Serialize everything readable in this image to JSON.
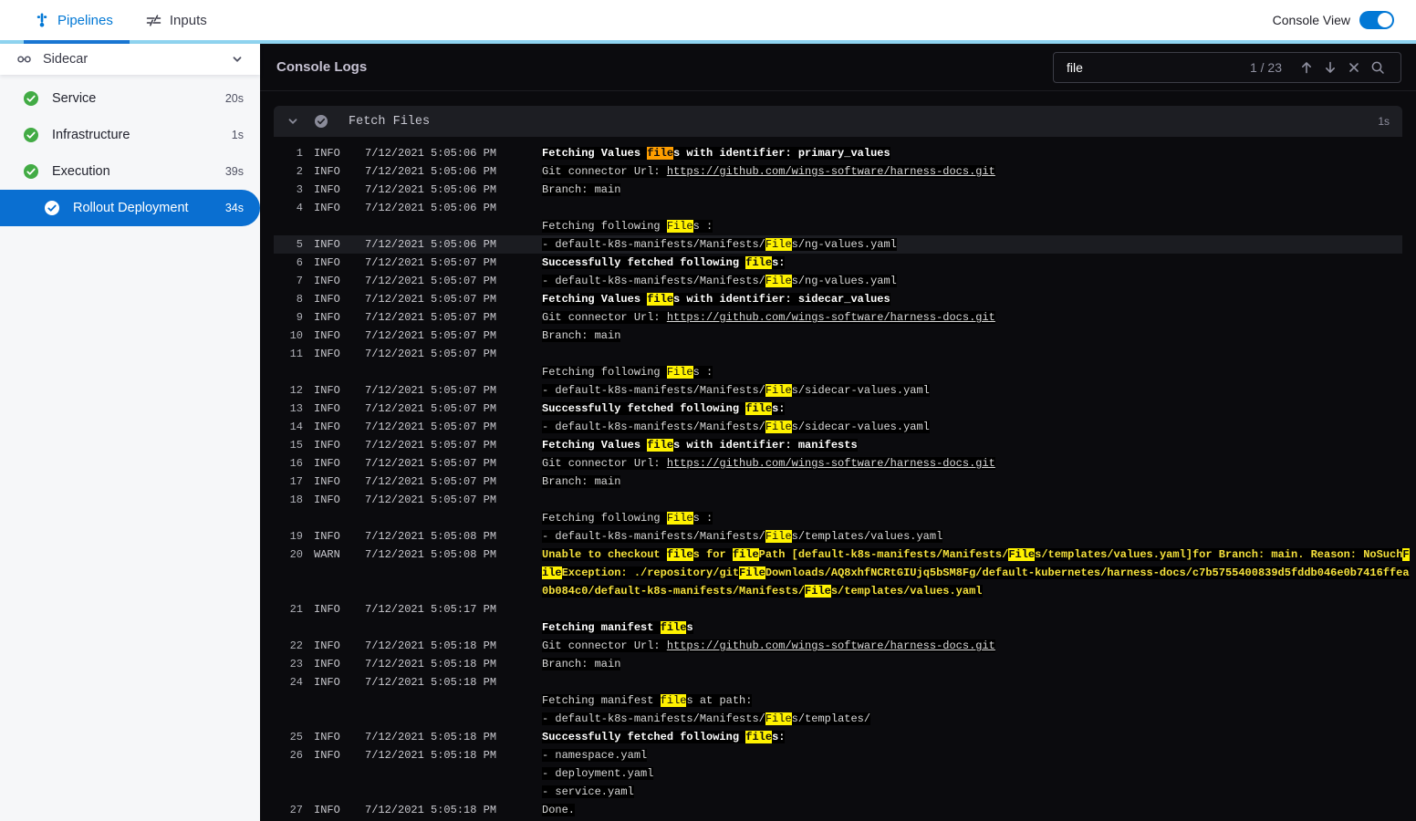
{
  "colors": {
    "accent_blue": "#0278d5",
    "selected_step_blue": "#0a6fd1",
    "tab_track_lightblue": "#8ed3ef",
    "tab_indicator_blue": "#1976d2",
    "success_green": "#42ab45",
    "console_bg": "#0b0b0e",
    "warn_yellow": "#f5e13c",
    "match_highlight": "#fff200",
    "current_match_highlight": "#ff9e00"
  },
  "topbar": {
    "tabs": [
      {
        "label": "Pipelines",
        "active": true
      },
      {
        "label": "Inputs",
        "active": false
      }
    ],
    "console_view_label": "Console View",
    "console_view_on": true
  },
  "sidebar": {
    "title": "Sidecar",
    "items": [
      {
        "label": "Service",
        "duration": "20s",
        "status": "success",
        "selected": false
      },
      {
        "label": "Infrastructure",
        "duration": "1s",
        "status": "success",
        "selected": false
      },
      {
        "label": "Execution",
        "duration": "39s",
        "status": "success",
        "selected": false
      },
      {
        "label": "Rollout Deployment",
        "duration": "34s",
        "status": "success",
        "selected": true
      }
    ]
  },
  "console": {
    "title": "Console Logs",
    "search": {
      "value": "file",
      "counter": "1 / 23"
    },
    "section": {
      "title": "Fetch Files",
      "duration": "1s"
    },
    "logs": [
      {
        "n": 1,
        "lv": "INFO",
        "ts": "7/12/2021 5:05:06 PM",
        "lines": [
          [
            {
              "t": "Fetching Values ",
              "s": "b"
            },
            {
              "t": "file",
              "s": "b",
              "h": "c"
            },
            {
              "t": "s with identifier: primary_values",
              "s": "b"
            }
          ]
        ]
      },
      {
        "n": 2,
        "lv": "INFO",
        "ts": "7/12/2021 5:05:06 PM",
        "lines": [
          [
            {
              "t": "Git connector Url: "
            },
            {
              "t": "https://github.com/wings-software/harness-docs.git",
              "s": "l"
            }
          ]
        ]
      },
      {
        "n": 3,
        "lv": "INFO",
        "ts": "7/12/2021 5:05:06 PM",
        "lines": [
          [
            {
              "t": "Branch: main"
            }
          ]
        ]
      },
      {
        "n": 4,
        "lv": "INFO",
        "ts": "7/12/2021 5:05:06 PM",
        "lines": [
          [],
          [
            {
              "t": "Fetching following "
            },
            {
              "t": "File",
              "h": "m"
            },
            {
              "t": "s :"
            }
          ]
        ]
      },
      {
        "n": 5,
        "lv": "INFO",
        "ts": "7/12/2021 5:05:06 PM",
        "sel": true,
        "lines": [
          [
            {
              "t": "- default-k8s-manifests/Manifests/"
            },
            {
              "t": "File",
              "h": "m"
            },
            {
              "t": "s/ng-values.yaml"
            }
          ]
        ]
      },
      {
        "n": 6,
        "lv": "INFO",
        "ts": "7/12/2021 5:05:07 PM",
        "lines": [
          [
            {
              "t": "Successfully fetched following ",
              "s": "b"
            },
            {
              "t": "file",
              "s": "b",
              "h": "m"
            },
            {
              "t": "s:",
              "s": "b"
            }
          ]
        ]
      },
      {
        "n": 7,
        "lv": "INFO",
        "ts": "7/12/2021 5:05:07 PM",
        "lines": [
          [
            {
              "t": "- default-k8s-manifests/Manifests/"
            },
            {
              "t": "File",
              "h": "m"
            },
            {
              "t": "s/ng-values.yaml"
            }
          ]
        ]
      },
      {
        "n": 8,
        "lv": "INFO",
        "ts": "7/12/2021 5:05:07 PM",
        "lines": [
          [
            {
              "t": "Fetching Values ",
              "s": "b"
            },
            {
              "t": "file",
              "s": "b",
              "h": "m"
            },
            {
              "t": "s with identifier: sidecar_values",
              "s": "b"
            }
          ]
        ]
      },
      {
        "n": 9,
        "lv": "INFO",
        "ts": "7/12/2021 5:05:07 PM",
        "lines": [
          [
            {
              "t": "Git connector Url: "
            },
            {
              "t": "https://github.com/wings-software/harness-docs.git",
              "s": "l"
            }
          ]
        ]
      },
      {
        "n": 10,
        "lv": "INFO",
        "ts": "7/12/2021 5:05:07 PM",
        "lines": [
          [
            {
              "t": "Branch: main"
            }
          ]
        ]
      },
      {
        "n": 11,
        "lv": "INFO",
        "ts": "7/12/2021 5:05:07 PM",
        "lines": [
          [],
          [
            {
              "t": "Fetching following "
            },
            {
              "t": "File",
              "h": "m"
            },
            {
              "t": "s :"
            }
          ]
        ]
      },
      {
        "n": 12,
        "lv": "INFO",
        "ts": "7/12/2021 5:05:07 PM",
        "lines": [
          [
            {
              "t": "- default-k8s-manifests/Manifests/"
            },
            {
              "t": "File",
              "h": "m"
            },
            {
              "t": "s/sidecar-values.yaml"
            }
          ]
        ]
      },
      {
        "n": 13,
        "lv": "INFO",
        "ts": "7/12/2021 5:05:07 PM",
        "lines": [
          [
            {
              "t": "Successfully fetched following ",
              "s": "b"
            },
            {
              "t": "file",
              "s": "b",
              "h": "m"
            },
            {
              "t": "s:",
              "s": "b"
            }
          ]
        ]
      },
      {
        "n": 14,
        "lv": "INFO",
        "ts": "7/12/2021 5:05:07 PM",
        "lines": [
          [
            {
              "t": "- default-k8s-manifests/Manifests/"
            },
            {
              "t": "File",
              "h": "m"
            },
            {
              "t": "s/sidecar-values.yaml"
            }
          ]
        ]
      },
      {
        "n": 15,
        "lv": "INFO",
        "ts": "7/12/2021 5:05:07 PM",
        "lines": [
          [
            {
              "t": "Fetching Values ",
              "s": "b"
            },
            {
              "t": "file",
              "s": "b",
              "h": "m"
            },
            {
              "t": "s with identifier: manifests",
              "s": "b"
            }
          ]
        ]
      },
      {
        "n": 16,
        "lv": "INFO",
        "ts": "7/12/2021 5:05:07 PM",
        "lines": [
          [
            {
              "t": "Git connector Url: "
            },
            {
              "t": "https://github.com/wings-software/harness-docs.git",
              "s": "l"
            }
          ]
        ]
      },
      {
        "n": 17,
        "lv": "INFO",
        "ts": "7/12/2021 5:05:07 PM",
        "lines": [
          [
            {
              "t": "Branch: main"
            }
          ]
        ]
      },
      {
        "n": 18,
        "lv": "INFO",
        "ts": "7/12/2021 5:05:07 PM",
        "lines": [
          [],
          [
            {
              "t": "Fetching following "
            },
            {
              "t": "File",
              "h": "m"
            },
            {
              "t": "s :"
            }
          ]
        ]
      },
      {
        "n": 19,
        "lv": "INFO",
        "ts": "7/12/2021 5:05:08 PM",
        "lines": [
          [
            {
              "t": "- default-k8s-manifests/Manifests/"
            },
            {
              "t": "File",
              "h": "m"
            },
            {
              "t": "s/templates/values.yaml"
            }
          ]
        ]
      },
      {
        "n": 20,
        "lv": "WARN",
        "ts": "7/12/2021 5:05:08 PM",
        "lines": [
          [
            {
              "t": "Unable to checkout ",
              "s": "w"
            },
            {
              "t": "file",
              "s": "w",
              "h": "m"
            },
            {
              "t": "s for ",
              "s": "w"
            },
            {
              "t": "file",
              "s": "w",
              "h": "m"
            },
            {
              "t": "Path [default-k8s-manifests/Manifests/",
              "s": "w"
            },
            {
              "t": "File",
              "s": "w",
              "h": "m"
            },
            {
              "t": "s/templates/values.yaml]for Branch: main. Reason: NoSuch",
              "s": "w"
            },
            {
              "t": "F",
              "s": "w",
              "h": "m"
            }
          ],
          [
            {
              "t": "ile",
              "s": "w",
              "h": "m"
            },
            {
              "t": "Exception: ./repository/git",
              "s": "w"
            },
            {
              "t": "File",
              "s": "w",
              "h": "m"
            },
            {
              "t": "Downloads/AQ8xhfNCRtGIUjq5bSM8Fg/default-kubernetes/harness-docs/c7b5755400839d5fddb046e0b7416ffea",
              "s": "w"
            }
          ],
          [
            {
              "t": "0b084c0/default-k8s-manifests/Manifests/",
              "s": "w"
            },
            {
              "t": "File",
              "s": "w",
              "h": "m"
            },
            {
              "t": "s/templates/values.yaml",
              "s": "w"
            }
          ]
        ]
      },
      {
        "n": 21,
        "lv": "INFO",
        "ts": "7/12/2021 5:05:17 PM",
        "lines": [
          [],
          [
            {
              "t": "Fetching manifest ",
              "s": "b"
            },
            {
              "t": "file",
              "s": "b",
              "h": "m"
            },
            {
              "t": "s",
              "s": "b"
            }
          ]
        ]
      },
      {
        "n": 22,
        "lv": "INFO",
        "ts": "7/12/2021 5:05:18 PM",
        "lines": [
          [
            {
              "t": "Git connector Url: "
            },
            {
              "t": "https://github.com/wings-software/harness-docs.git",
              "s": "l"
            }
          ]
        ]
      },
      {
        "n": 23,
        "lv": "INFO",
        "ts": "7/12/2021 5:05:18 PM",
        "lines": [
          [
            {
              "t": "Branch: main"
            }
          ]
        ]
      },
      {
        "n": 24,
        "lv": "INFO",
        "ts": "7/12/2021 5:05:18 PM",
        "lines": [
          [],
          [
            {
              "t": "Fetching manifest "
            },
            {
              "t": "file",
              "h": "m"
            },
            {
              "t": "s at path:"
            }
          ],
          [
            {
              "t": "- default-k8s-manifests/Manifests/"
            },
            {
              "t": "File",
              "h": "m"
            },
            {
              "t": "s/templates/"
            }
          ]
        ]
      },
      {
        "n": 25,
        "lv": "INFO",
        "ts": "7/12/2021 5:05:18 PM",
        "lines": [
          [
            {
              "t": "Successfully fetched following ",
              "s": "b"
            },
            {
              "t": "file",
              "s": "b",
              "h": "m"
            },
            {
              "t": "s:",
              "s": "b"
            }
          ]
        ]
      },
      {
        "n": 26,
        "lv": "INFO",
        "ts": "7/12/2021 5:05:18 PM",
        "lines": [
          [
            {
              "t": "- namespace.yaml"
            }
          ],
          [
            {
              "t": "- deployment.yaml"
            }
          ],
          [
            {
              "t": "- service.yaml"
            }
          ]
        ]
      },
      {
        "n": 27,
        "lv": "INFO",
        "ts": "7/12/2021 5:05:18 PM",
        "lines": [
          [
            {
              "t": "Done."
            }
          ]
        ]
      }
    ]
  }
}
